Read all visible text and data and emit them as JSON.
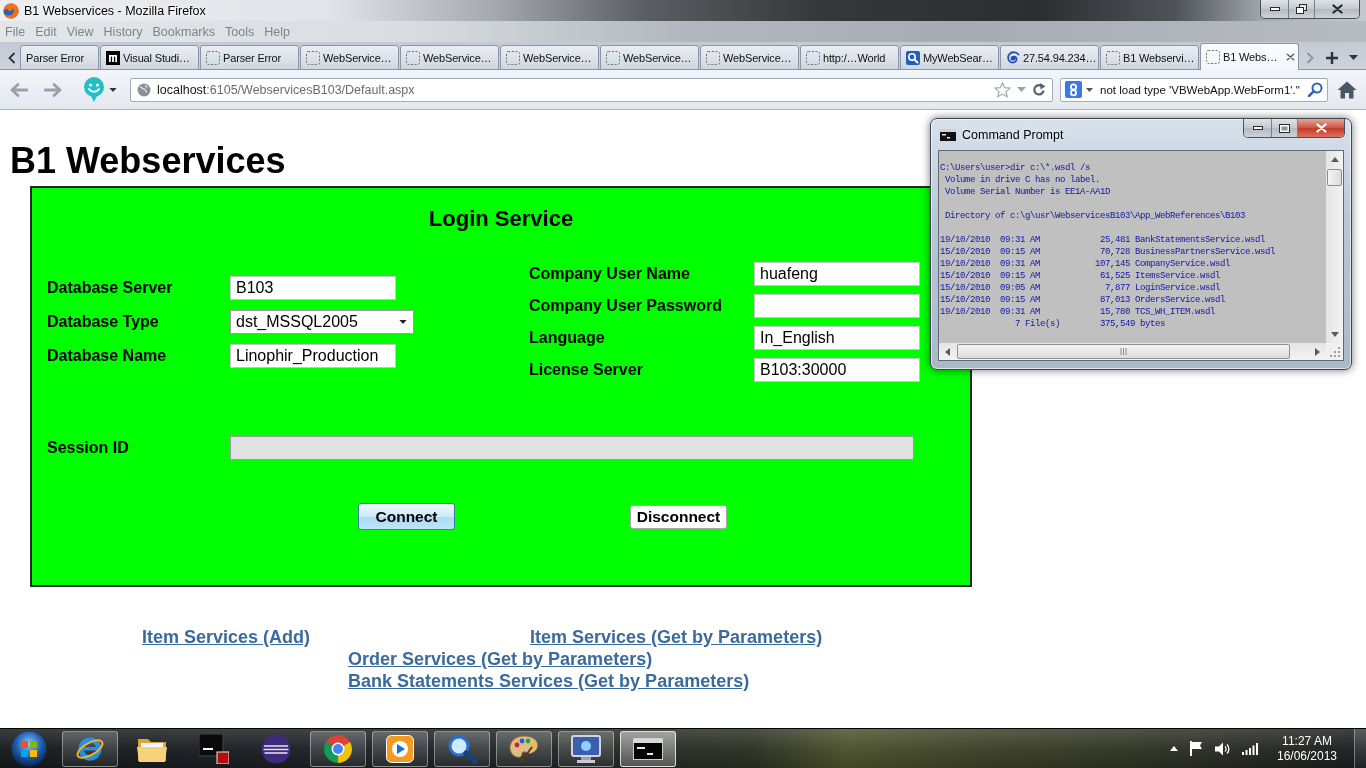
{
  "window": {
    "title": "B1 Webservices - Mozilla Firefox"
  },
  "menu_bar": [
    "File",
    "Edit",
    "View",
    "History",
    "Bookmarks",
    "Tools",
    "Help"
  ],
  "tabs": [
    {
      "label": "Parser Error",
      "kind": "clipped",
      "selected": false
    },
    {
      "label": "Visual Studi…",
      "kind": "tile-logo",
      "selected": false
    },
    {
      "label": "Parser Error",
      "kind": "blank",
      "selected": false
    },
    {
      "label": "WebService…",
      "kind": "blank",
      "selected": false
    },
    {
      "label": "WebService…",
      "kind": "blank",
      "selected": false
    },
    {
      "label": "WebService…",
      "kind": "blank",
      "selected": false
    },
    {
      "label": "WebService…",
      "kind": "blank",
      "selected": false
    },
    {
      "label": "WebService…",
      "kind": "blank",
      "selected": false
    },
    {
      "label": "http:/…World",
      "kind": "blank",
      "selected": false
    },
    {
      "label": "MyWebSear…",
      "kind": "search",
      "selected": false
    },
    {
      "label": "27.54.94.234…",
      "kind": "swirl",
      "selected": false
    },
    {
      "label": "B1 Webservi…",
      "kind": "blank",
      "selected": false
    },
    {
      "label": "B1 Webs…",
      "kind": "blank",
      "selected": true
    }
  ],
  "address_bar": {
    "host": "localhost",
    "path": ":6105/WebservicesB103/Default.aspx"
  },
  "search_bar": {
    "value": "not load type 'VBWebApp.WebForm1'.\""
  },
  "page": {
    "heading": "B1 Webservices",
    "login_panel": {
      "title": "Login Service",
      "left_fields": [
        {
          "label": "Database Server",
          "kind": "text",
          "value": "B103"
        },
        {
          "label": "Database Type",
          "kind": "select",
          "value": "dst_MSSQL2005"
        },
        {
          "label": "Database Name",
          "kind": "text",
          "value": "Linophir_Production"
        }
      ],
      "right_fields": [
        {
          "label": "Company User Name",
          "value": "huafeng"
        },
        {
          "label": "Company User Password"
        },
        {
          "label": "Language",
          "value": "In_English"
        },
        {
          "label": "License Server",
          "value": "B103:30000"
        }
      ],
      "session": {
        "label": "Session ID",
        "disabled": true
      },
      "buttons": [
        {
          "label": "Connect",
          "focused": true
        },
        {
          "label": "Disconnect",
          "focused": false
        }
      ]
    },
    "link_rows": [
      [
        "Item Services (Add)",
        "Item Services (Get by Parameters)"
      ],
      [
        "Order Services (Get by Parameters)"
      ],
      [
        "Bank Statements Services (Get by Parameters)"
      ]
    ]
  },
  "console_window": {
    "title": "Command Prompt",
    "blocks": [
      [
        "C:\\Users\\user>dir c:\\*.wsdl /s",
        " Volume in drive C has no label.",
        " Volume Serial Number is EE1A-AA1D"
      ],
      [
        " Directory of c:\\g\\usr\\WebservicesB103\\App_WebReferences\\B103"
      ],
      [
        "19/10/2010  09:31 AM            25,481 BankStatementsService.wsdl",
        "15/10/2010  09:15 AM            70,728 BusinessPartnersService.wsdl",
        "19/10/2010  09:31 AM           107,145 CompanyService.wsdl",
        "15/10/2010  09:15 AM            61,525 ItemsService.wsdl",
        "15/10/2010  09:05 AM             7,877 LoginService.wsdl",
        "15/10/2010  09:15 AM            87,013 OrdersService.wsdl",
        "19/10/2010  09:31 AM            15,780 TCS_WH_ITEM.wsdl",
        "               7 File(s)        375,549 bytes"
      ]
    ]
  },
  "taskbar": {
    "apps": [
      {
        "kind": "e-logo",
        "running": true,
        "selected": false
      },
      {
        "kind": "folder",
        "running": false,
        "selected": false
      },
      {
        "kind": "squares",
        "running": false,
        "selected": false
      },
      {
        "kind": "sphere",
        "running": false,
        "selected": false
      },
      {
        "kind": "ring",
        "running": true,
        "selected": false
      },
      {
        "kind": "play",
        "running": true,
        "selected": false
      },
      {
        "kind": "magnifier",
        "running": true,
        "selected": false
      },
      {
        "kind": "palette",
        "running": true,
        "selected": false
      },
      {
        "kind": "monitor",
        "running": true,
        "selected": false
      },
      {
        "kind": "console",
        "running": true,
        "selected": true
      }
    ],
    "time": "11:27 AM",
    "date": "16/06/2013"
  }
}
